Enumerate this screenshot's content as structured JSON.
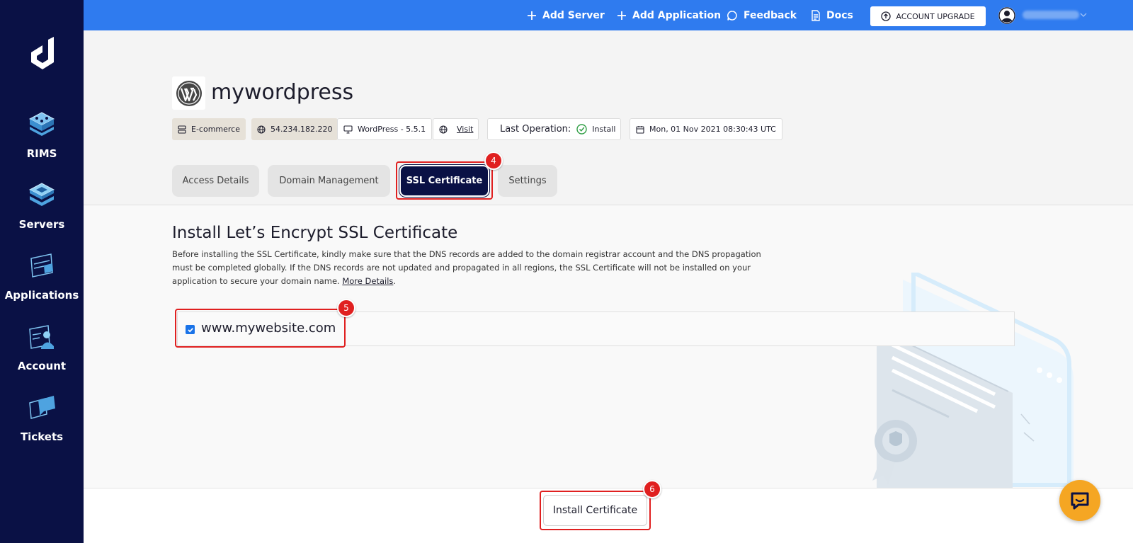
{
  "sidebar": {
    "items": [
      {
        "label": "RIMS",
        "icon": "rims-icon"
      },
      {
        "label": "Servers",
        "icon": "servers-icon"
      },
      {
        "label": "Applications",
        "icon": "applications-icon"
      },
      {
        "label": "Account",
        "icon": "account-icon"
      },
      {
        "label": "Tickets",
        "icon": "tickets-icon"
      }
    ]
  },
  "topbar": {
    "add_server": "Add Server",
    "add_application": "Add Application",
    "feedback": "Feedback",
    "docs": "Docs",
    "account_upgrade": "ACCOUNT UPGRADE"
  },
  "app": {
    "title": "mywordpress",
    "chips": {
      "category": "E-commerce",
      "ip": "54.234.182.220",
      "platform": "WordPress - 5.5.1",
      "visit": "Visit",
      "last_operation_label": "Last Operation:",
      "last_operation_value": "Install",
      "date": "Mon, 01 Nov 2021 08:30:43 UTC"
    }
  },
  "tabs": [
    {
      "label": "Access Details",
      "active": false
    },
    {
      "label": "Domain Management",
      "active": false
    },
    {
      "label": "SSL Certificate",
      "active": true
    },
    {
      "label": "Settings",
      "active": false
    }
  ],
  "ssl": {
    "title": "Install Let’s Encrypt SSL Certificate",
    "description": "Before installing the SSL Certificate, kindly make sure that the DNS records are added to the domain registrar account and the DNS propagation must be completed globally. If the DNS records are not updated and propagated in all regions, the SSL Certificate will not be installed on your application to secure your domain name.",
    "more_details": "More Details",
    "domain": "www.mywebsite.com",
    "domain_checked": true
  },
  "footer": {
    "install_button": "Install Certificate"
  },
  "annotations": {
    "step_4": "4",
    "step_5": "5",
    "step_6": "6"
  },
  "colors": {
    "sidebar": "#0a1145",
    "topbar": "#2f7bef",
    "highlight": "#e02020",
    "chat": "#f5a623"
  }
}
